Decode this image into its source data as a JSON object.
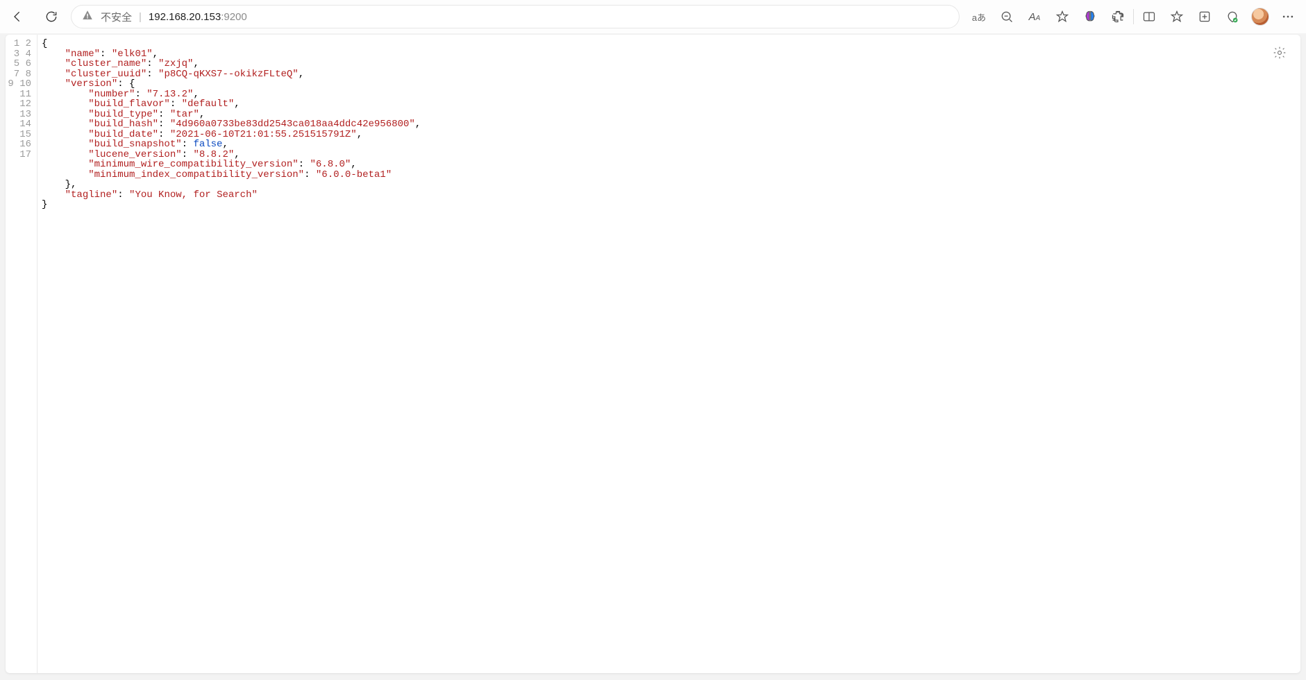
{
  "browser": {
    "unsafe_label": "不安全",
    "separator": "|",
    "host": "192.168.20.153",
    "port": ":9200",
    "char_hint": "aあ"
  },
  "line_numbers": [
    "1",
    "2",
    "3",
    "4",
    "5",
    "6",
    "7",
    "8",
    "9",
    "10",
    "11",
    "12",
    "13",
    "14",
    "15",
    "16",
    "17"
  ],
  "code": {
    "l1": "{",
    "l2_key": "\"name\"",
    "l2_val": "\"elk01\"",
    "l3_key": "\"cluster_name\"",
    "l3_val": "\"zxjq\"",
    "l4_key": "\"cluster_uuid\"",
    "l4_val": "\"p8CQ-qKXS7--okikzFLteQ\"",
    "l5_key": "\"version\"",
    "l6_key": "\"number\"",
    "l6_val": "\"7.13.2\"",
    "l7_key": "\"build_flavor\"",
    "l7_val": "\"default\"",
    "l8_key": "\"build_type\"",
    "l8_val": "\"tar\"",
    "l9_key": "\"build_hash\"",
    "l9_val": "\"4d960a0733be83dd2543ca018aa4ddc42e956800\"",
    "l10_key": "\"build_date\"",
    "l10_val": "\"2021-06-10T21:01:55.251515791Z\"",
    "l11_key": "\"build_snapshot\"",
    "l11_val": "false",
    "l12_key": "\"lucene_version\"",
    "l12_val": "\"8.8.2\"",
    "l13_key": "\"minimum_wire_compatibility_version\"",
    "l13_val": "\"6.8.0\"",
    "l14_key": "\"minimum_index_compatibility_version\"",
    "l14_val": "\"6.0.0-beta1\"",
    "l16_key": "\"tagline\"",
    "l16_val": "\"You Know, for Search\"",
    "l17": "}"
  }
}
